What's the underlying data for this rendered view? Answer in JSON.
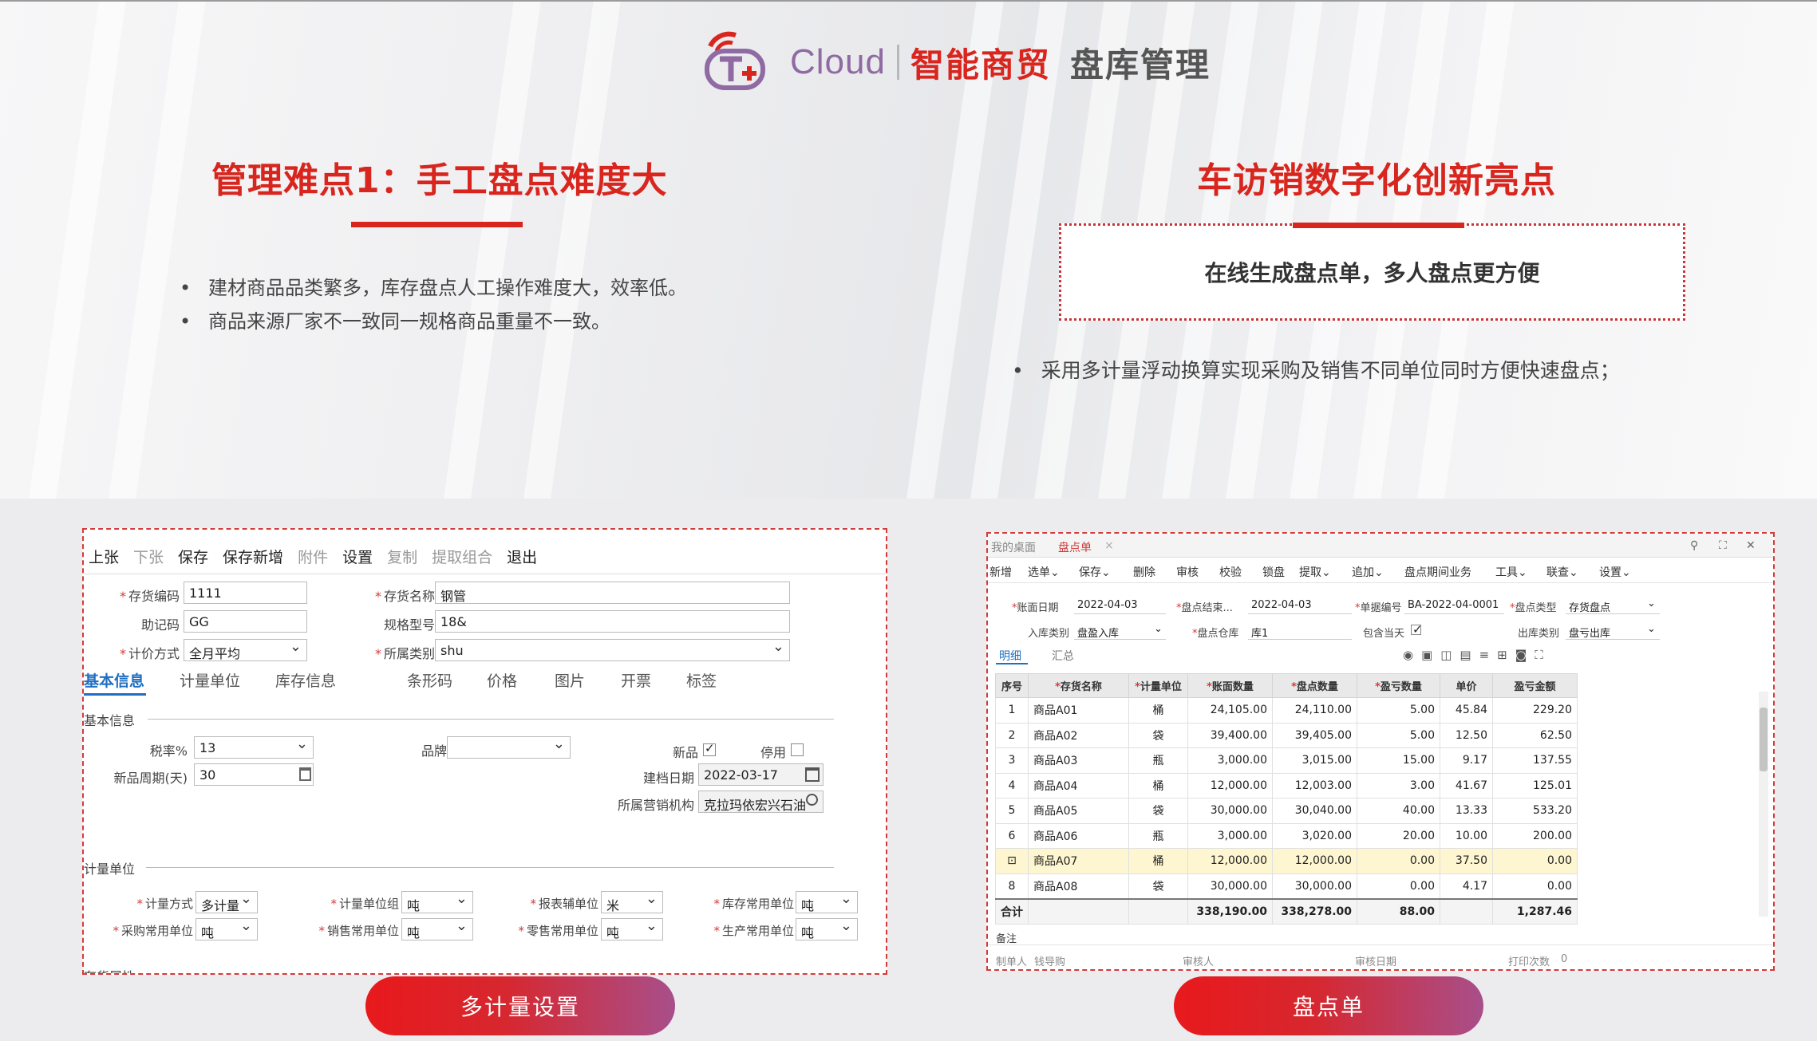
{
  "header": {
    "cloud_text": "Cloud",
    "brand": "智能商贸",
    "module": "盘库管理",
    "logo_icon": "tplus-cloud-logo"
  },
  "left": {
    "title": "管理难点1：手工盘点难度大",
    "bullets": [
      "建材商品品类繁多，库存盘点人工操作难度大，效率低。",
      "商品来源厂家不一致同一规格商品重量不一致。"
    ]
  },
  "right": {
    "title": "车访销数字化创新亮点",
    "highlight": "在线生成盘点单，多人盘点更方便",
    "bullet": "采用多计量浮动换算实现采购及销售不同单位同时方便快速盘点；"
  },
  "left_shot": {
    "toolbar": [
      {
        "label": "上张",
        "enabled": true
      },
      {
        "label": "下张",
        "enabled": false
      },
      {
        "label": "保存",
        "enabled": true
      },
      {
        "label": "保存新增",
        "enabled": true
      },
      {
        "label": "附件",
        "enabled": false
      },
      {
        "label": "设置",
        "enabled": true
      },
      {
        "label": "复制",
        "enabled": false
      },
      {
        "label": "提取组合",
        "enabled": false
      },
      {
        "label": "退出",
        "enabled": true
      }
    ],
    "fields": {
      "code_label": "存货编码",
      "code_value": "1111",
      "name_label": "存货名称",
      "name_value": "钢管",
      "mnemonic_label": "助记码",
      "mnemonic_value": "GG",
      "spec_label": "规格型号",
      "spec_value": "18&",
      "pricing_label": "计价方式",
      "pricing_value": "全月平均",
      "category_label": "所属类别",
      "category_value": "shu"
    },
    "tabs": [
      "基本信息",
      "计量单位",
      "库存信息",
      "条形码",
      "价格",
      "图片",
      "开票",
      "标签"
    ],
    "basic": {
      "section": "基本信息",
      "tax_label": "税率%",
      "tax_value": "13",
      "brand_label": "品牌",
      "brand_value": "",
      "new_label": "新品",
      "disable_label": "停用",
      "cycle_label": "新品周期(天)",
      "cycle_value": "30",
      "date_label": "建档日期",
      "date_value": "2022-03-17",
      "org_label": "所属营销机构",
      "org_value": "克拉玛依宏兴石油"
    },
    "units": {
      "section": "计量单位",
      "method_label": "计量方式",
      "method_value": "多计量",
      "group_label": "计量单位组",
      "group_value": "吨",
      "report_label": "报表辅单位",
      "report_value": "米",
      "stock_label": "库存常用单位",
      "stock_value": "吨",
      "purchase_label": "采购常用单位",
      "purchase_value": "吨",
      "sales_label": "销售常用单位",
      "sales_value": "吨",
      "retail_label": "零售常用单位",
      "retail_value": "吨",
      "production_label": "生产常用单位",
      "production_value": "吨"
    },
    "cut_section": "存货属性"
  },
  "left_button": "多计量设置",
  "right_shot": {
    "tabs": [
      "我的桌面",
      "盘点单"
    ],
    "toolbar": [
      "新增",
      "选单⌄",
      "保存⌄",
      "删除",
      "审核",
      "校验",
      "锁盘",
      "提取⌄",
      "追加⌄",
      "盘点期间业务",
      "工具⌄",
      "联查⌄",
      "设置⌄"
    ],
    "header_fields": {
      "book_date_label": "账面日期",
      "book_date": "2022-04-03",
      "count_end_label": "盘点结束...",
      "count_end": "2022-04-03",
      "doc_no_label": "单据编号",
      "doc_no": "BA-2022-04-0001",
      "count_type_label": "盘点类型",
      "count_type": "存货盘点",
      "in_type_label": "入库类别",
      "in_type": "盘盈入库",
      "warehouse_label": "盘点仓库",
      "warehouse": "库1",
      "include_day_label": "包含当天",
      "out_type_label": "出库类别",
      "out_type": "盘亏出库"
    },
    "subtabs": [
      "明细",
      "汇总"
    ],
    "columns": [
      "序号",
      "存货名称",
      "计量单位",
      "账面数量",
      "盘点数量",
      "盈亏数量",
      "单价",
      "盈亏金额"
    ],
    "rows": [
      [
        "1",
        "商品A01",
        "桶",
        "24,105.00",
        "24,110.00",
        "5.00",
        "45.84",
        "229.20"
      ],
      [
        "2",
        "商品A02",
        "袋",
        "39,400.00",
        "39,405.00",
        "5.00",
        "12.50",
        "62.50"
      ],
      [
        "3",
        "商品A03",
        "瓶",
        "3,000.00",
        "3,015.00",
        "15.00",
        "9.17",
        "137.55"
      ],
      [
        "4",
        "商品A04",
        "桶",
        "12,000.00",
        "12,003.00",
        "3.00",
        "41.67",
        "125.01"
      ],
      [
        "5",
        "商品A05",
        "袋",
        "30,000.00",
        "30,040.00",
        "40.00",
        "13.33",
        "533.20"
      ],
      [
        "6",
        "商品A06",
        "瓶",
        "3,000.00",
        "3,020.00",
        "20.00",
        "10.00",
        "200.00"
      ],
      [
        "",
        "商品A07",
        "桶",
        "12,000.00",
        "12,000.00",
        "0.00",
        "37.50",
        "0.00"
      ],
      [
        "8",
        "商品A08",
        "袋",
        "30,000.00",
        "30,000.00",
        "0.00",
        "4.17",
        "0.00"
      ]
    ],
    "total": [
      "合计",
      "",
      "",
      "338,190.00",
      "338,278.00",
      "88.00",
      "",
      "1,287.46"
    ],
    "footer": {
      "remark_label": "备注",
      "maker_label": "制单人",
      "maker": "钱导购",
      "auditor_label": "审核人",
      "audit_date_label": "审核日期",
      "print_label": "打印次数",
      "print_count": "0"
    }
  },
  "right_button": "盘点单",
  "colors": {
    "brand_red": "#d8261e",
    "link_blue": "#1f6fc2",
    "pill_end": "#a84f8a"
  }
}
